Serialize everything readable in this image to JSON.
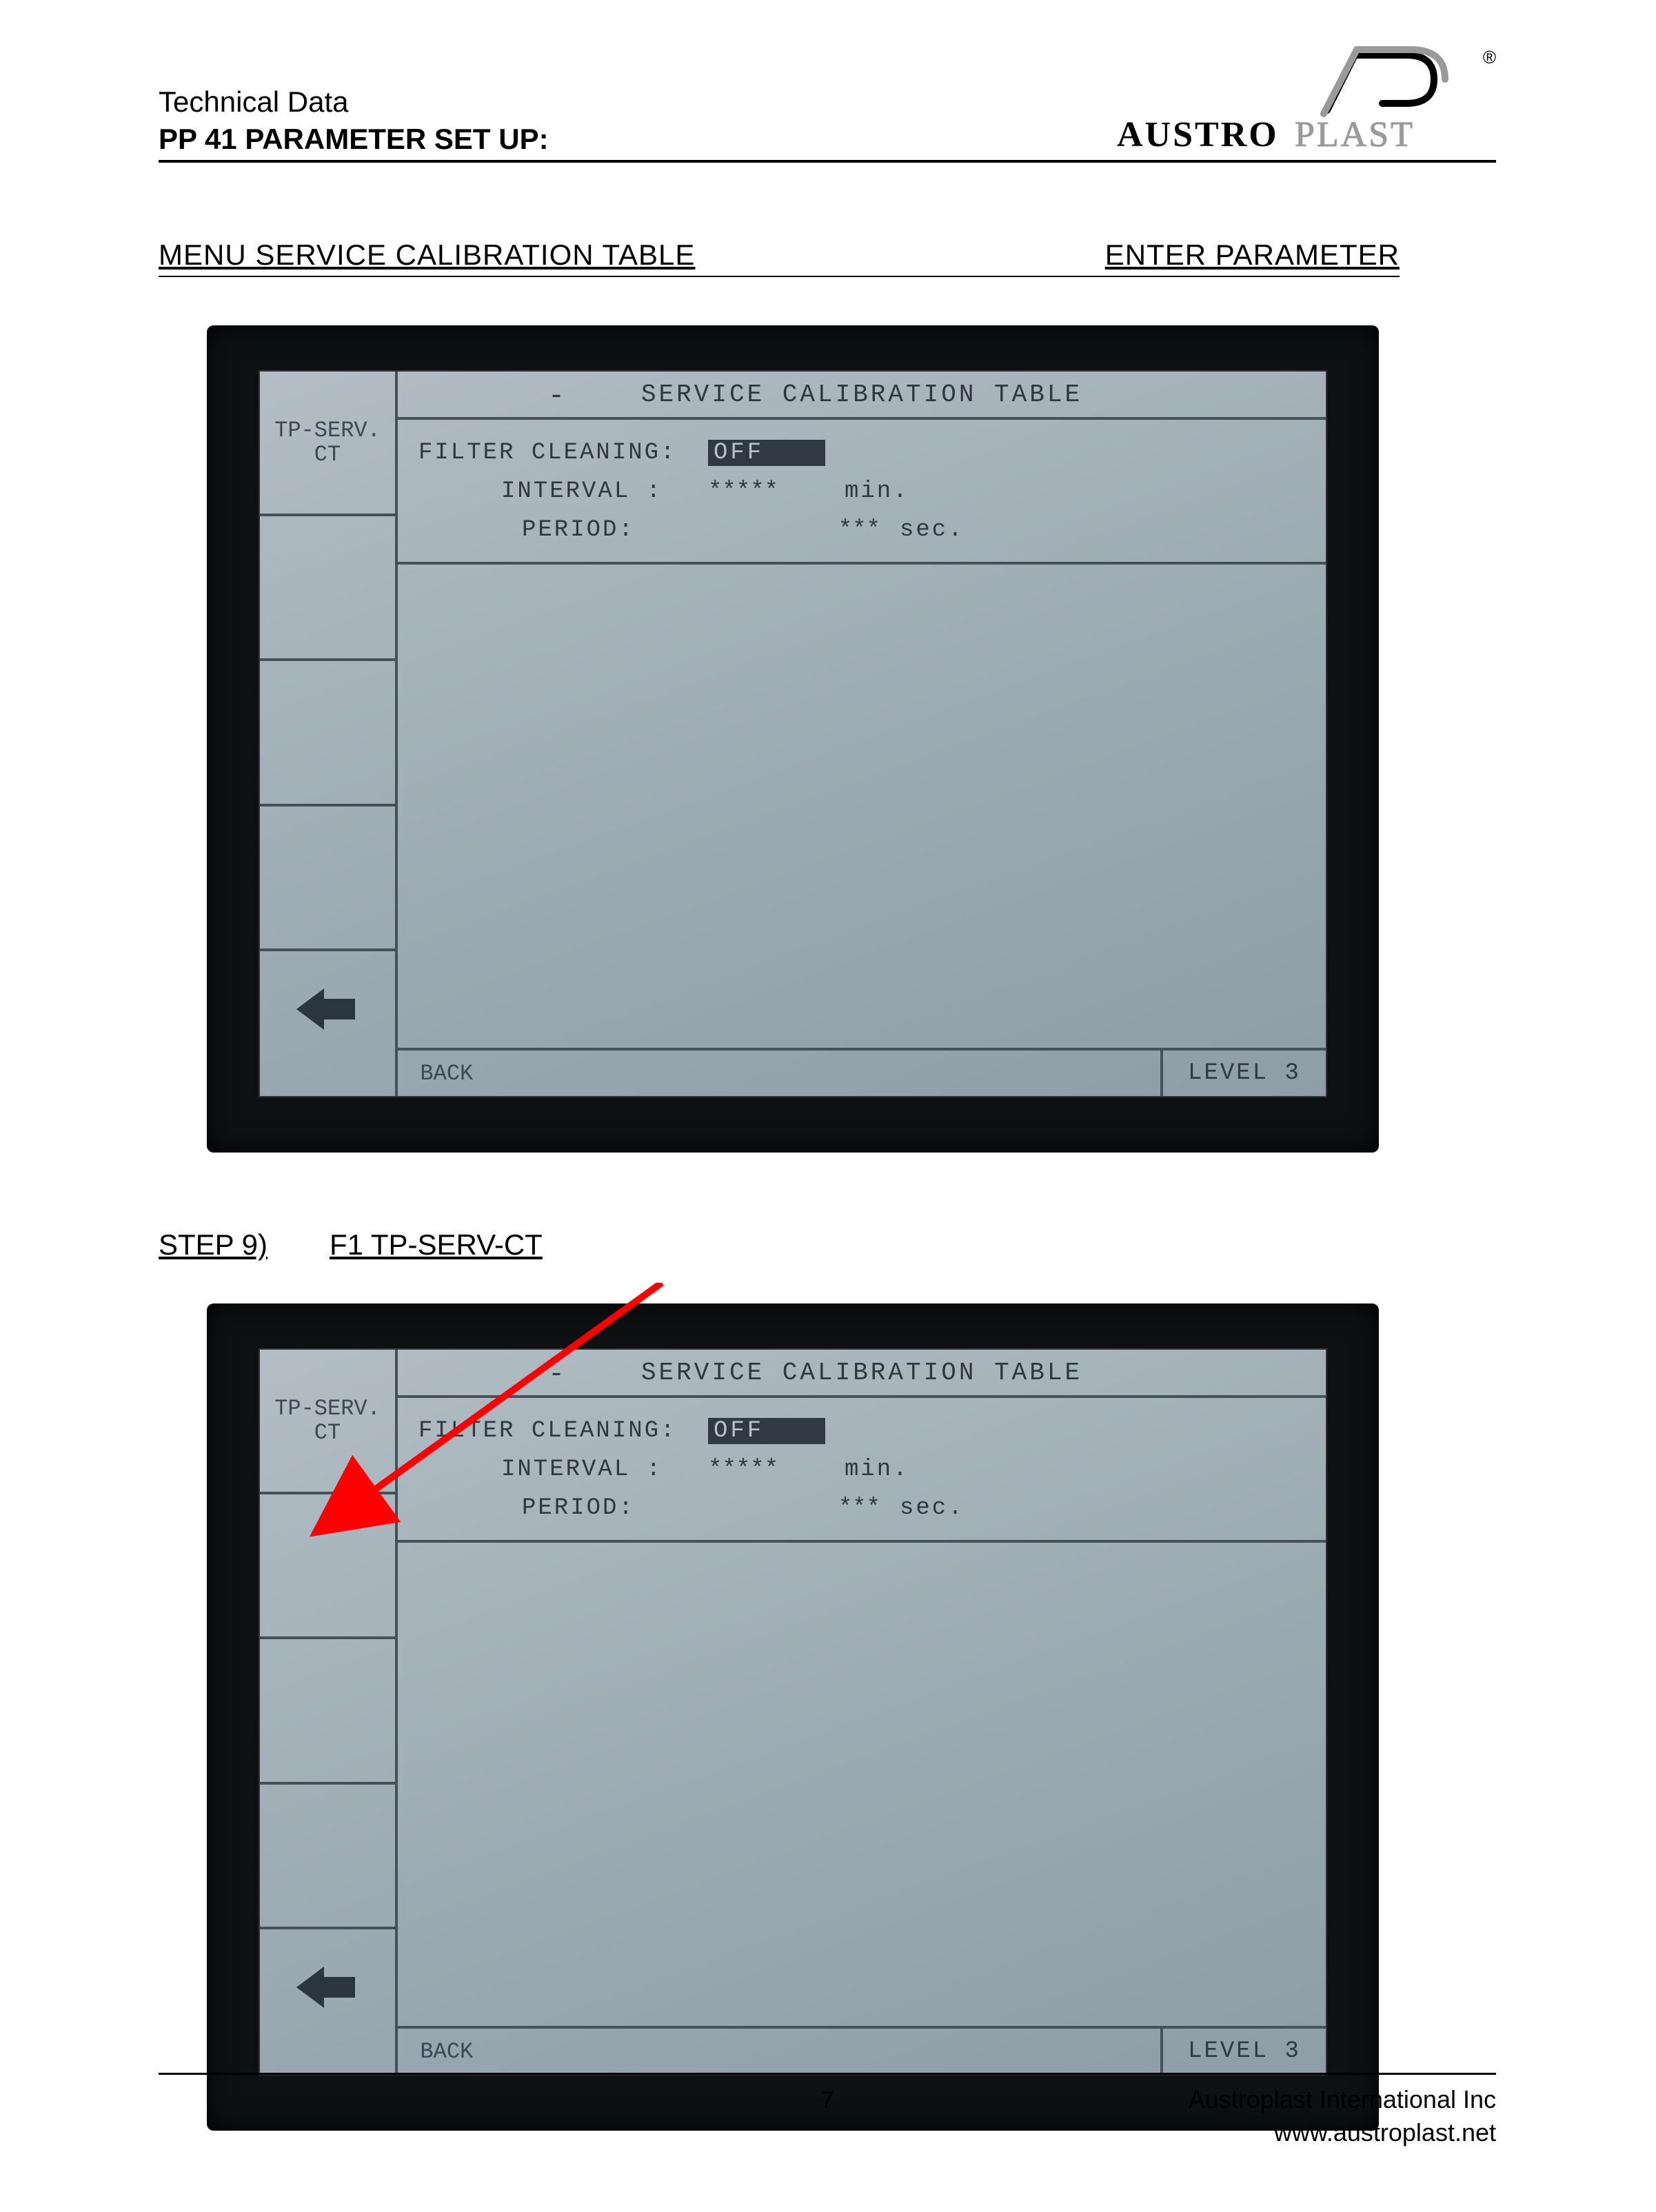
{
  "header": {
    "tech": "Technical Data",
    "title": "PP 41 PARAMETER SET UP:",
    "brand_bold": "AUSTRO",
    "brand_light": "PLAST",
    "reg": "®"
  },
  "section1": {
    "heading_left": "MENU SERVICE CALIBRATION TABLE",
    "heading_right": "ENTER PARAMETER"
  },
  "screen": {
    "title": "SERVICE CALIBRATION TABLE",
    "dash": "-",
    "side_tp": "TP-SERV.\nCT",
    "back": "BACK",
    "level": "LEVEL 3",
    "filter_label": "FILTER CLEANING:",
    "filter_value": "OFF",
    "interval_label": "INTERVAL :",
    "interval_value": "*****",
    "interval_unit": "min.",
    "period_label": "PERIOD:",
    "period_value": "***",
    "period_unit": "sec."
  },
  "section2": {
    "step": "STEP 9)",
    "label": "F1 TP-SERV-CT"
  },
  "footer": {
    "page": "7",
    "company": "Austroplast International Inc",
    "url": "www.austroplast.net"
  }
}
